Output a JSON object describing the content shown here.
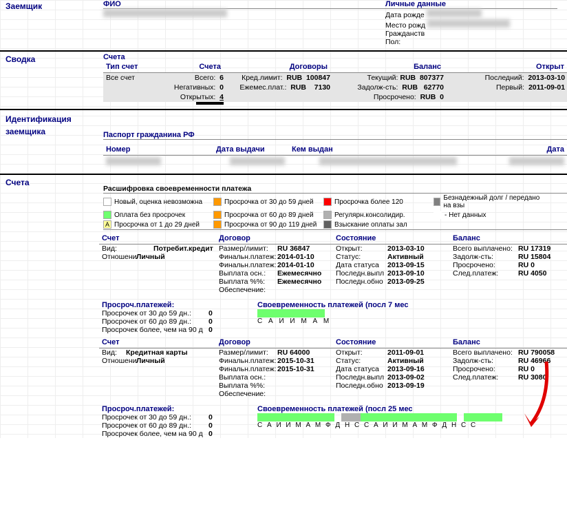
{
  "borrower": {
    "title": "Заемщик",
    "fio_label": "ФИО",
    "personal_title": "Личные данные",
    "birthdate_label": "Дата рожде",
    "birthdate_val": "",
    "birthplace_label": "Место рожд",
    "citizenship_label": "Гражданств",
    "sex_label": "Пол:"
  },
  "summary": {
    "title": "Сводка",
    "accounts_title": "Счета",
    "hdr_type": "Тип счет",
    "hdr_accts": "Счета",
    "hdr_contracts": "Договоры",
    "hdr_balance": "Баланс",
    "hdr_opened": "Открыт",
    "all_accts": "Все счет",
    "total_l": "Всего:",
    "total_v": "6",
    "neg_l": "Негативных:",
    "neg_v": "0",
    "open_l": "Открытых:",
    "open_v": "4",
    "cred_limit_l": "Кред.лимит:",
    "cred_limit_c": "RUB",
    "cred_limit_v": "100847",
    "monthly_l": "Ежемес.плат.:",
    "monthly_c": "RUB",
    "monthly_v": "7130",
    "current_l": "Текущий:",
    "current_c": "RUB",
    "current_v": "807377",
    "debt_l": "Задолж-сть:",
    "debt_c": "RUB",
    "debt_v": "62770",
    "overdue_l": "Просрочено:",
    "overdue_c": "RUB",
    "overdue_v": "0",
    "last_l": "Последний:",
    "last_v": "2013-03-10",
    "first_l": "Первый:",
    "first_v": "2011-09-01"
  },
  "ident": {
    "title1": "Идентификация",
    "title2": "заемщика",
    "passport_title": "Паспорт гражданина РФ",
    "num_l": "Номер",
    "issue_l": "Дата выдачи",
    "issuer_l": "Кем выдан",
    "date_l": "Дата"
  },
  "accounts_section": {
    "title": "Счета",
    "legend_title": "Расшифровка своевременности платежа",
    "legend": [
      {
        "color": "#ffffff",
        "text": "Новый, оценка невозможна"
      },
      {
        "color": "#ff9900",
        "text": "Просрочка от 30 до 59 дней"
      },
      {
        "color": "#ff0000",
        "text": "Просрочка более 120"
      },
      {
        "color": "#808080",
        "text": "Безнадежный долг / передано на взы"
      },
      {
        "color": "#6eff6e",
        "text": "Оплата без просрочек"
      },
      {
        "color": "#ff9900",
        "text": "Просрочка от 60 до 89 дней"
      },
      {
        "color": "#b0b0b0",
        "text": "Регулярн.консолидир."
      },
      {
        "color": "#ffffff",
        "text": "- Нет данных",
        "noborder": true
      },
      {
        "color": "#ffff99",
        "text": "Просрочка от 1 до 29 дней",
        "letter": "A"
      },
      {
        "color": "#ff9900",
        "text": "Просрочка от 90 до 119 дней"
      },
      {
        "color": "#606060",
        "text": "Взыскание оплаты зал"
      }
    ]
  },
  "acct1": {
    "hdr_acct": "Счет",
    "hdr_contract": "Договор",
    "hdr_state": "Состояние",
    "hdr_balance": "Баланс",
    "type_l": "Вид:",
    "type_v": "Потребит.кредит",
    "rel_l": "Отношени",
    "rel_v": "Личный",
    "size_l": "Размер/лимит:",
    "size_v": "RU 36847",
    "final_l": "Финальн.платеж:",
    "final_v": "2014-01-10",
    "final2_l": "Финальн.платеж:",
    "final2_v": "2014-01-10",
    "pay_l": "Выплата осн.:",
    "pay_v": "Ежемесячно",
    "payp_l": "Выплата %%:",
    "payp_v": "Ежемесячно",
    "sec_l": "Обеспечение:",
    "open_l": "Открыт:",
    "open_v": "2013-03-10",
    "status_l": "Статус:",
    "status_v": "Активный",
    "statdate_l": "Дата статуса",
    "statdate_v": "2013-09-15",
    "lastpay_l": "Последн.выпл",
    "lastpay_v": "2013-09-10",
    "lastupd_l": "Последн.обно",
    "lastupd_v": "2013-09-25",
    "totalpaid_l": "Всего выплачено:",
    "totalpaid_v": "RU 17319",
    "baldebt_l": "Задолж-сть:",
    "baldebt_v": "RU 15804",
    "overdue_l": "Просрочено:",
    "overdue_v": "RU 0",
    "next_l": "След.платеж:",
    "next_v": "RU 4050",
    "od_title": "Просроч.платежей:",
    "od30_l": "Просрочек от 30 до 59 дн.:",
    "od30_v": "0",
    "od60_l": "Просрочек от 60 до 89 дн.:",
    "od60_v": "0",
    "od90_l": "Просрочек более, чем на 90 д",
    "od90_v": "0",
    "timely_title": "Своевременность платежей (посл 7 мес",
    "timely_letters": "С А И И М А М"
  },
  "acct2": {
    "hdr_acct": "Счет",
    "hdr_contract": "Договор",
    "hdr_state": "Состояние",
    "hdr_balance": "Баланс",
    "type_l": "Вид:",
    "type_v": "Кредитная карты",
    "rel_l": "Отношени",
    "rel_v": "Личный",
    "size_l": "Размер/лимит:",
    "size_v": "RU 64000",
    "final_l": "Финальн.платеж:",
    "final_v": "2015-10-31",
    "final2_l": "Финальн.платеж:",
    "final2_v": "2015-10-31",
    "pay_l": "Выплата осн.:",
    "payp_l": "Выплата %%:",
    "sec_l": "Обеспечение:",
    "open_l": "Открыт:",
    "open_v": "2011-09-01",
    "status_l": "Статус:",
    "status_v": "Активный",
    "statdate_l": "Дата статуса",
    "statdate_v": "2013-09-16",
    "lastpay_l": "Последн.выпл",
    "lastpay_v": "2013-09-02",
    "lastupd_l": "Последн.обно",
    "lastupd_v": "2013-09-19",
    "totalpaid_l": "Всего выплачено:",
    "totalpaid_v": "RU 790058",
    "baldebt_l": "Задолж-сть:",
    "baldebt_v": "RU 46966",
    "overdue_l": "Просрочено:",
    "overdue_v": "RU 0",
    "next_l": "След.платеж:",
    "next_v": "RU 3080",
    "od_title": "Просроч.платежей:",
    "od30_l": "Просрочек от 30 до 59 дн.:",
    "od30_v": "0",
    "od60_l": "Просрочек от 60 до 89 дн.:",
    "od60_v": "0",
    "od90_l": "Просрочек более, чем на 90 д",
    "od90_v": "0",
    "timely_title": "Своевременность платежей (посл 25 мес",
    "timely_letters": "С А И И М А М Ф   Д Н С С А И И М А М Ф   Д Н С С"
  }
}
